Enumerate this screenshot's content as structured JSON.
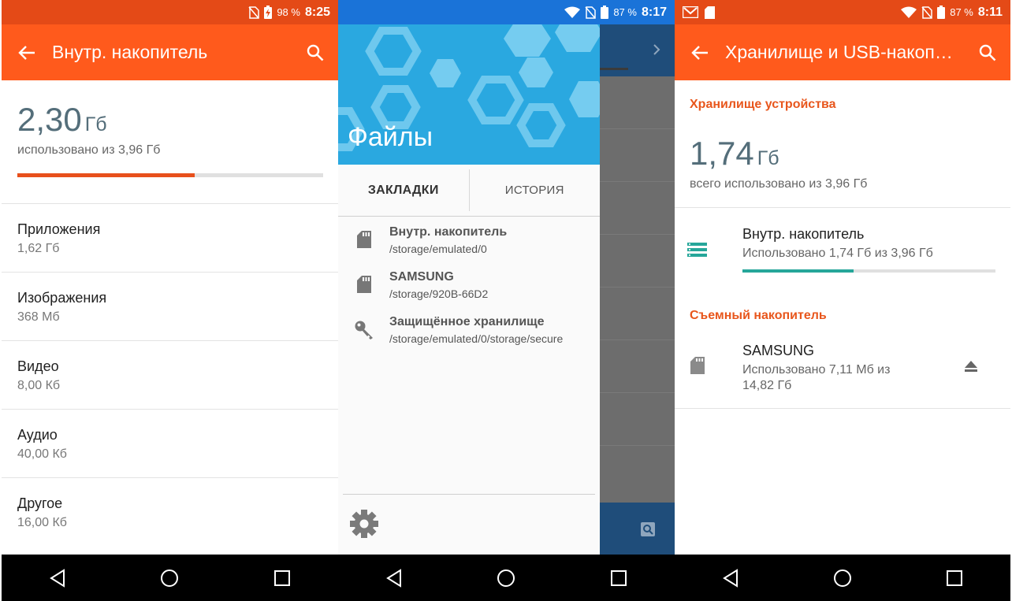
{
  "panel1": {
    "status": {
      "battery": "98 %",
      "time": "8:25"
    },
    "appbar": {
      "title": "Внутр. накопитель"
    },
    "usage": {
      "amount": "2,30",
      "unit": "Гб",
      "subtitle": "использовано из 3,96 Гб",
      "fraction": 0.58,
      "bar_color": "#e8501c"
    },
    "categories": [
      {
        "label": "Приложения",
        "value": "1,62 Гб"
      },
      {
        "label": "Изображения",
        "value": "368 Мб"
      },
      {
        "label": "Видео",
        "value": "8,00 Кб"
      },
      {
        "label": "Аудио",
        "value": "40,00 Кб"
      },
      {
        "label": "Другое",
        "value": "16,00 Кб"
      }
    ]
  },
  "panel2": {
    "status": {
      "battery": "87 %",
      "time": "8:17"
    },
    "drawer": {
      "title": "Файлы",
      "tabs": [
        {
          "label": "ЗАКЛАДКИ"
        },
        {
          "label": "ИСТОРИЯ"
        }
      ],
      "bookmarks": [
        {
          "name": "Внутр. накопитель",
          "path": "/storage/emulated/0",
          "icon": "sd-card-icon"
        },
        {
          "name": "SAMSUNG",
          "path": "/storage/920B-66D2",
          "icon": "sd-card-icon"
        },
        {
          "name": "Защищённое хранилище",
          "path": "/storage/emulated/0/storage/secure",
          "icon": "key-icon"
        }
      ]
    }
  },
  "panel3": {
    "status": {
      "battery": "87 %",
      "time": "8:11"
    },
    "appbar": {
      "title": "Хранилище и USB-накопители"
    },
    "device_section": "Хранилище устройства",
    "usage": {
      "amount": "1,74",
      "unit": "Гб",
      "subtitle": "всего использовано из 3,96 Гб"
    },
    "internal": {
      "name": "Внутр. накопитель",
      "desc": "Использовано 1,74 Гб из 3,96 Гб",
      "fraction": 0.44,
      "bar_color": "#26a69a"
    },
    "removable_section": "Съемный накопитель",
    "removable": {
      "name": "SAMSUNG",
      "desc_line1": "Использовано 7,11 Мб из",
      "desc_line2": "14,82 Гб"
    }
  },
  "colors": {
    "accent": "#ff5a1c",
    "status_orange": "#e44a17",
    "status_blue": "#1a73d8",
    "teal": "#26a69a"
  }
}
